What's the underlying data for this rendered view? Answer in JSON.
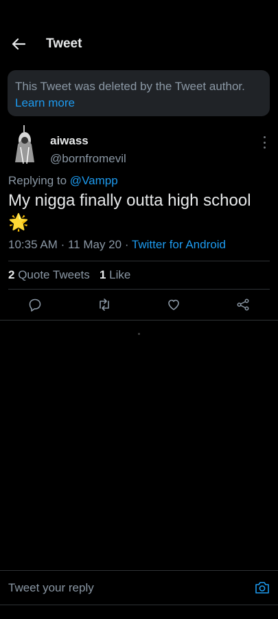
{
  "header": {
    "title": "Tweet",
    "back_icon": "arrow-left-icon"
  },
  "deleted_notice": {
    "text": "This Tweet was deleted by the Tweet author.",
    "link": "Learn more"
  },
  "tweet": {
    "author_name": "aiwass",
    "author_handle": "@bornfromevil",
    "replying_prefix": "Replying to",
    "replying_to": "@Vampp",
    "text": "My nigga finally outta high school",
    "emoji": "🌟",
    "time": "10:35 AM",
    "date": "11 May 20",
    "separator": "·",
    "source": "Twitter for Android"
  },
  "stats": {
    "quote_count": "2",
    "quote_label": "Quote Tweets",
    "like_count": "1",
    "like_label": "Like"
  },
  "actions": [
    "reply-icon",
    "retweet-icon",
    "like-icon",
    "share-icon"
  ],
  "reply": {
    "placeholder": "Tweet your reply"
  },
  "colors": {
    "accent": "#1d9bf0",
    "muted": "#8b98a5",
    "card": "#202327",
    "border": "#2f3336"
  }
}
